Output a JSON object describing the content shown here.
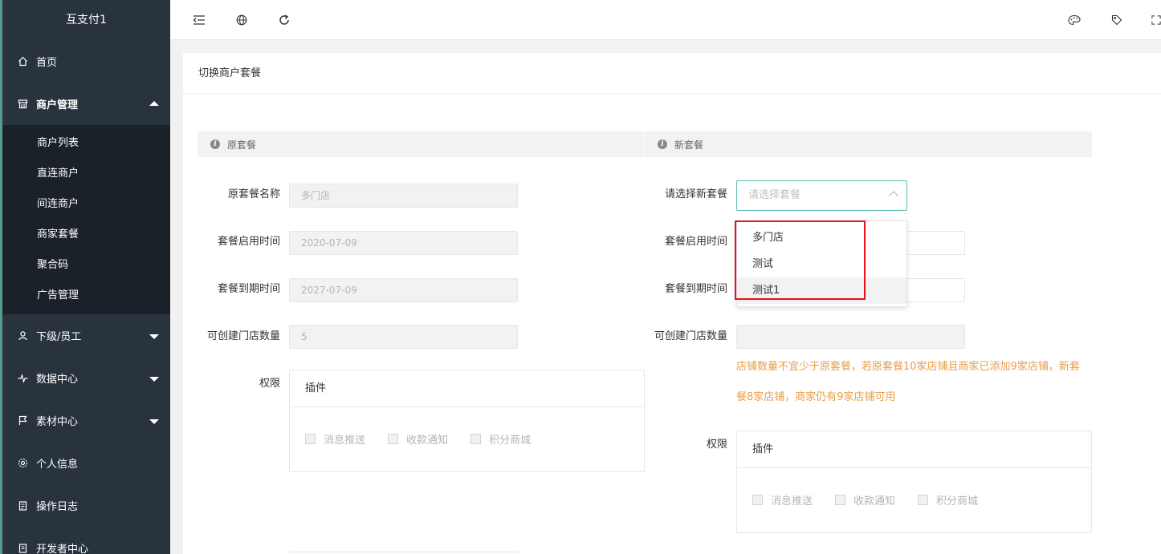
{
  "app_title": "互支付1",
  "sidebar": {
    "items": [
      {
        "label": "首页",
        "icon": "home-icon"
      },
      {
        "label": "商户管理",
        "icon": "shop-icon",
        "expanded": true,
        "children": [
          "商户列表",
          "直连商户",
          "间连商户",
          "商家套餐",
          "聚合码",
          "广告管理"
        ]
      },
      {
        "label": "下级/员工",
        "icon": "user-icon"
      },
      {
        "label": "数据中心",
        "icon": "pulse-icon"
      },
      {
        "label": "素材中心",
        "icon": "flag-icon"
      },
      {
        "label": "个人信息",
        "icon": "gear-icon"
      },
      {
        "label": "操作日志",
        "icon": "clipboard-icon"
      },
      {
        "label": "开发者中心",
        "icon": "clipboard-icon"
      }
    ]
  },
  "card": {
    "title": "切换商户套餐"
  },
  "old_plan": {
    "section_title": "原套餐",
    "name_label": "原套餐名称",
    "name_value": "多门店",
    "start_label": "套餐启用时间",
    "start_value": "2020-07-09",
    "end_label": "套餐到期时间",
    "end_value": "2027-07-09",
    "stores_label": "可创建门店数量",
    "stores_value": "5",
    "perm_label": "权限",
    "perm_header": "插件",
    "perms": [
      "消息推送",
      "收款通知",
      "积分商城"
    ]
  },
  "new_plan": {
    "section_title": "新套餐",
    "select_label": "请选择新套餐",
    "select_placeholder": "请选择套餐",
    "options": [
      "多门店",
      "测试",
      "测试1"
    ],
    "start_label": "套餐启用时间",
    "end_label": "套餐到期时间",
    "stores_label": "可创建门店数量",
    "tip_line1": "店铺数量不宜少于原套餐，若原套餐10家店铺且商家已添加9家店铺，新套",
    "tip_line2": "餐8家店铺，商家仍有9家店铺可用",
    "perm_label": "权限",
    "perm_header": "插件",
    "perms": [
      "消息推送",
      "收款通知",
      "积分商城"
    ]
  },
  "colors": {
    "sidebar_bg": "#28333e",
    "submenu_bg": "#1b2128",
    "accent": "#5fb8ac",
    "tip": "#e89d4a",
    "highlight": "#e8121d"
  }
}
